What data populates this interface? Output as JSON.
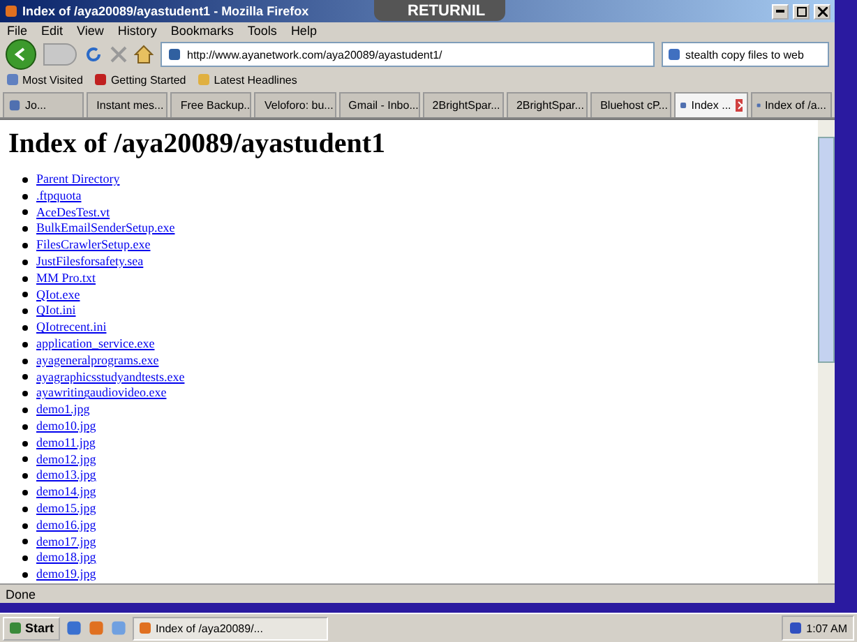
{
  "window": {
    "title": "Index of /aya20089/ayastudent1 - Mozilla Firefox",
    "badge": "RETURNIL"
  },
  "menu": [
    "File",
    "Edit",
    "View",
    "History",
    "Bookmarks",
    "Tools",
    "Help"
  ],
  "address": {
    "value": "http://www.ayanetwork.com/aya20089/ayastudent1/"
  },
  "search": {
    "value": "stealth copy files to web"
  },
  "bookmarks": [
    "Most Visited",
    "Getting Started",
    "Latest Headlines"
  ],
  "tabs": [
    {
      "label": "Jo...",
      "selected": false
    },
    {
      "label": "Instant mes...",
      "selected": false
    },
    {
      "label": "Free Backup...",
      "selected": false
    },
    {
      "label": "Veloforo: bu...",
      "selected": false
    },
    {
      "label": "Gmail - Inbo...",
      "selected": false
    },
    {
      "label": "2BrightSpar...",
      "selected": false
    },
    {
      "label": "2BrightSpar...",
      "selected": false
    },
    {
      "label": "Bluehost cP...",
      "selected": false
    },
    {
      "label": "Index ...",
      "selected": true
    },
    {
      "label": "Index of /a...",
      "selected": false
    }
  ],
  "page": {
    "heading": "Index of /aya20089/ayastudent1",
    "links": [
      "Parent Directory",
      ".ftpquota",
      "AceDesTest.vt",
      "BulkEmailSenderSetup.exe",
      "FilesCrawlerSetup.exe",
      "JustFilesforsafety.sea",
      "MM Pro.txt",
      "QIot.exe",
      "QIot.ini",
      "QIotrecent.ini",
      "application_service.exe",
      "ayageneralprograms.exe",
      "ayagraphicsstudyandtests.exe",
      "ayawritingaudiovideo.exe",
      "demo1.jpg",
      "demo10.jpg",
      "demo11.jpg",
      "demo12.jpg",
      "demo13.jpg",
      "demo14.jpg",
      "demo15.jpg",
      "demo16.jpg",
      "demo17.jpg",
      "demo18.jpg",
      "demo19.jpg"
    ]
  },
  "status_bar": "Done",
  "taskbar": {
    "start": "Start",
    "tasks": [
      "Index of /aya20089/..."
    ],
    "clock": "1:07 AM"
  }
}
